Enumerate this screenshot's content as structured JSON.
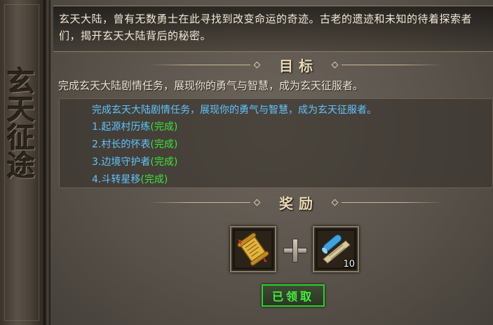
{
  "side_banner": {
    "title": "玄天征途"
  },
  "intro": {
    "text": "玄天大陆，曾有无数勇士在此寻找到改变命运的奇迹。古老的遗迹和未知的待着探索者们，揭开玄天大陆背后的秘密。"
  },
  "goal": {
    "header": "目标",
    "description": "完成玄天大陆剧情任务，展现你的勇气与智慧，成为玄天征服者。",
    "task_head": "完成玄天大陆剧情任务，展现你的勇气与智慧，成为玄天征服者。",
    "tasks": [
      {
        "label": "1.起源村历练",
        "status": "(完成)"
      },
      {
        "label": "2.村长的怀表",
        "status": "(完成)"
      },
      {
        "label": "3.边境守护者",
        "status": "(完成)"
      },
      {
        "label": "4.斗转星移",
        "status": "(完成)"
      }
    ]
  },
  "reward": {
    "header": "奖励",
    "items": [
      {
        "icon": "golden-scroll-icon",
        "count": ""
      },
      {
        "icon": "blue-scroll-icon",
        "count": "10"
      }
    ],
    "claim_button": "已领取"
  },
  "colors": {
    "task_blue": "#5fc4ff",
    "done_green": "#3ee23a",
    "header_gold": "#ead9b2"
  }
}
